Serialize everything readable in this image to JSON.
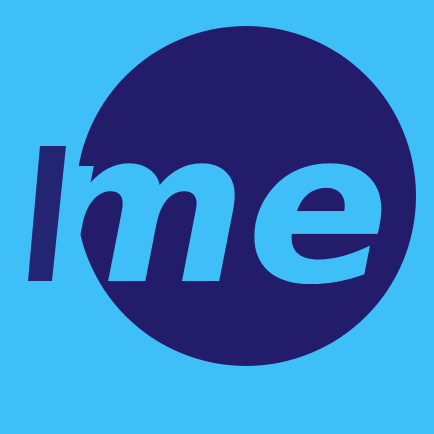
{
  "logo": {
    "text": "me",
    "colors": {
      "background": "#3fbff7",
      "circle": "#221c6b",
      "text": "#3fbff7"
    }
  }
}
